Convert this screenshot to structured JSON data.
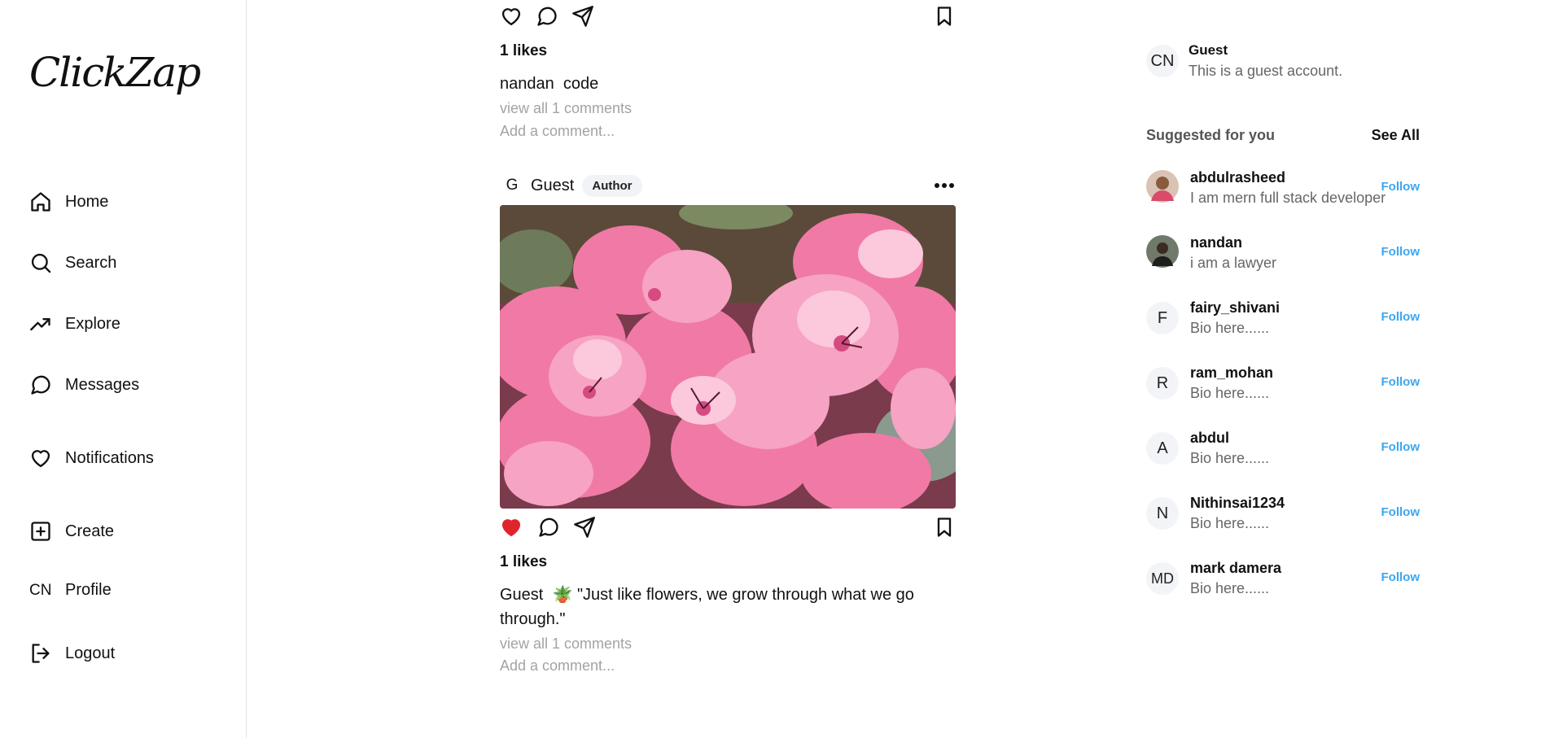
{
  "app": {
    "logo": "ClickZap"
  },
  "sidebar": {
    "items": [
      {
        "label": "Home",
        "icon": "home-icon"
      },
      {
        "label": "Search",
        "icon": "search-icon"
      },
      {
        "label": "Explore",
        "icon": "trending-icon"
      },
      {
        "label": "Messages",
        "icon": "message-icon"
      },
      {
        "label": "Notifications",
        "icon": "heart-icon"
      },
      {
        "label": "Create",
        "icon": "plus-square-icon"
      },
      {
        "label": "Profile",
        "icon_text": "CN"
      },
      {
        "label": "Logout",
        "icon": "logout-icon"
      }
    ]
  },
  "feed": {
    "post1": {
      "likes": "1 likes",
      "caption_user": "nandan",
      "caption_text": "code",
      "view_comments": "view all 1 comments",
      "add_comment": "Add a comment..."
    },
    "post2": {
      "avatar_letter": "G",
      "username": "Guest",
      "badge": "Author",
      "liked": true,
      "likes": "1 likes",
      "caption_user": "Guest",
      "caption_text": "🪴 \"Just like flowers, we grow through what we go through.\"",
      "view_comments": "view all 1 comments",
      "add_comment": "Add a comment..."
    }
  },
  "right": {
    "current_user": {
      "initials": "CN",
      "name": "Guest",
      "bio": "This is a guest account."
    },
    "suggested_title": "Suggested for you",
    "see_all": "See All",
    "follow_label": "Follow",
    "suggestions": [
      {
        "username": "abdulrasheed",
        "bio": "I am mern full stack developer",
        "avatar": "photo"
      },
      {
        "username": "nandan",
        "bio": "i am a lawyer",
        "avatar": "photo"
      },
      {
        "username": "fairy_shivani",
        "bio": "Bio here......",
        "initials": "F"
      },
      {
        "username": "ram_mohan",
        "bio": "Bio here......",
        "initials": "R"
      },
      {
        "username": "abdul",
        "bio": "Bio here......",
        "initials": "A"
      },
      {
        "username": "Nithinsai1234",
        "bio": "Bio here......",
        "initials": "N"
      },
      {
        "username": "mark damera",
        "bio": "Bio here......",
        "initials": "MD"
      }
    ]
  },
  "colors": {
    "like_red": "#e0242c",
    "follow_blue": "#3aa7f0",
    "badge_bg": "#f1f3f6"
  }
}
